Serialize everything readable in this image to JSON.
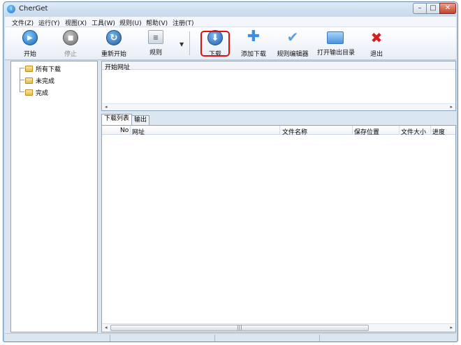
{
  "window": {
    "title": "CherGet",
    "app_icon_glyph": "i",
    "minimize_glyph": "–",
    "maximize_glyph": "□",
    "close_glyph": "✕"
  },
  "menu": [
    {
      "label": "文件(Z)"
    },
    {
      "label": "运行(Y)"
    },
    {
      "label": "视图(X)"
    },
    {
      "label": "工具(W)"
    },
    {
      "label": "规则(U)"
    },
    {
      "label": "帮助(V)"
    },
    {
      "label": "注册(T)"
    }
  ],
  "toolbar": {
    "start": {
      "label": "开始",
      "icon": "play-icon",
      "glyph": "▶"
    },
    "stop": {
      "label": "停止",
      "icon": "stop-icon",
      "glyph": "■",
      "disabled": true
    },
    "restart": {
      "label": "重新开始",
      "icon": "refresh-icon",
      "glyph": "↻"
    },
    "rule": {
      "label": "规则",
      "icon": "document-icon",
      "glyph": "≡"
    },
    "rule_dropdown_glyph": "▼",
    "download": {
      "label": "下载",
      "icon": "download-icon",
      "glyph": "⬇"
    },
    "add_download": {
      "label": "添加下载",
      "icon": "plus-icon",
      "glyph": "✚"
    },
    "rule_editor": {
      "label": "规则编辑器",
      "icon": "checkmark-icon",
      "glyph": "✔"
    },
    "open_output": {
      "label": "打开输出目录",
      "icon": "folder-icon"
    },
    "exit": {
      "label": "退出",
      "icon": "close-x-icon",
      "glyph": "✖"
    }
  },
  "tree": [
    {
      "label": "所有下载"
    },
    {
      "label": "未完成"
    },
    {
      "label": "完成"
    }
  ],
  "url_panel": {
    "header": "开始网址",
    "scroll_left_glyph": "◂",
    "scroll_right_glyph": "▸"
  },
  "tabs": [
    {
      "label": "下载列表",
      "active": true
    },
    {
      "label": "输出",
      "active": false
    }
  ],
  "list": {
    "columns": [
      {
        "label": "No"
      },
      {
        "label": "网址"
      },
      {
        "label": "文件名称"
      },
      {
        "label": "保存位置"
      },
      {
        "label": "文件大小"
      },
      {
        "label": "进度"
      }
    ],
    "rows": [],
    "scroll_left_glyph": "◂",
    "scroll_right_glyph": "▸",
    "thumb_grip": "|||"
  },
  "colors": {
    "highlight": "#e01010",
    "window_frame": "#c9dcee"
  }
}
